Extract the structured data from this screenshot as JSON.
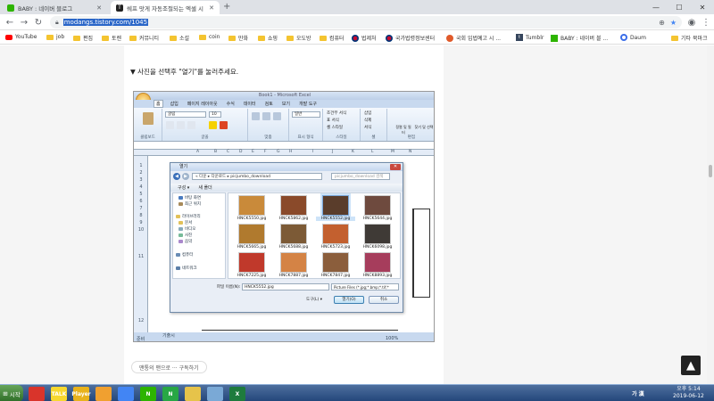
{
  "browser": {
    "tabs": [
      {
        "title": "BABY : 네이버 블로그",
        "active": false
      },
      {
        "title": "쉐프 맛게 자동조절되는 엑셀 시",
        "active": true
      }
    ],
    "url": "modangs.tistory.com/1045",
    "bookmarks": [
      {
        "label": "YouTube",
        "icon": "youtube-icon"
      },
      {
        "label": "job",
        "icon": "folder-icon"
      },
      {
        "label": "편집",
        "icon": "folder-icon"
      },
      {
        "label": "토렌",
        "icon": "folder-icon"
      },
      {
        "label": "커뮤니티",
        "icon": "folder-icon"
      },
      {
        "label": "소설",
        "icon": "folder-icon"
      },
      {
        "label": "coin",
        "icon": "folder-icon"
      },
      {
        "label": "만화",
        "icon": "folder-icon"
      },
      {
        "label": "쇼핑",
        "icon": "folder-icon"
      },
      {
        "label": "오도방",
        "icon": "folder-icon"
      },
      {
        "label": "컴퓨터",
        "icon": "folder-icon"
      },
      {
        "label": "법제처",
        "icon": "flag-icon"
      },
      {
        "label": "국가법령정보센터",
        "icon": "flag-icon"
      },
      {
        "label": "국회 입법예고 시 ...",
        "icon": "globe-icon"
      },
      {
        "label": "Tumblr",
        "icon": "tumblr-icon"
      },
      {
        "label": "BABY : 네이버 블 ...",
        "icon": "naver-icon"
      },
      {
        "label": "Daum",
        "icon": "daum-icon"
      },
      {
        "label": "기타 북마크",
        "icon": "folder-icon"
      }
    ]
  },
  "page": {
    "instruction": "▼ 사진을 선택후 \"열기\"를 눌러주세요.",
    "subscribe": "맨통의 맨으로 ··· 구독하기"
  },
  "excel": {
    "title": "Book1 - Microsoft Excel",
    "menu_tabs": [
      "홈",
      "삽입",
      "페이지 레이아웃",
      "수식",
      "데이터",
      "검토",
      "보기",
      "개발 도구"
    ],
    "ribbon_groups": [
      "클립보드",
      "글꼴",
      "맞춤",
      "표시 형식",
      "스타일",
      "셀",
      "편집"
    ],
    "font_name": "굴림",
    "font_size": "10",
    "number_format": "일반",
    "cell_styles": [
      "조건부 서식",
      "표 서식",
      "셀 스타일"
    ],
    "cells": [
      "삽입",
      "삭제",
      "서식"
    ],
    "edit_buttons": [
      "정렬 및 필터",
      "찾기 및 선택"
    ],
    "columns": [
      "A",
      "B",
      "C",
      "D",
      "E",
      "F",
      "G",
      "H",
      "I",
      "J",
      "K",
      "L",
      "M",
      "N"
    ],
    "rows": [
      "1",
      "2",
      "3",
      "4",
      "5",
      "6",
      "7",
      "8",
      "9",
      "10",
      "11",
      "12"
    ],
    "sheet_tab": "기출시",
    "status": "준비",
    "zoom": "100%"
  },
  "dialog": {
    "title": "열기",
    "path": "« 다운 ▸ 다운로드 ▸ picjumbo_download",
    "search_placeholder": "picjumbo_download 검색",
    "organize": "구성 ▾",
    "new_folder": "새 폴더",
    "nav_items": [
      "바탕 화면",
      "최근 위치",
      "라이브러리",
      "문서",
      "비디오",
      "사진",
      "음악",
      "컴퓨터",
      "네트워크"
    ],
    "files": [
      {
        "name": "HNCK5550.jpg",
        "color": "#c98a3a",
        "selected": false
      },
      {
        "name": "HNCK5862.jpg",
        "color": "#8a4a2a",
        "selected": false
      },
      {
        "name": "HNCK5552.jpg",
        "color": "#5a3d2b",
        "selected": true
      },
      {
        "name": "HNCK5644.jpg",
        "color": "#6e4a3e",
        "selected": false
      },
      {
        "name": "HNCK5665.jpg",
        "color": "#b07a2e",
        "selected": false
      },
      {
        "name": "HNCK5688.jpg",
        "color": "#7c5a36",
        "selected": false
      },
      {
        "name": "HNCK5723.jpg",
        "color": "#c3602f",
        "selected": false
      },
      {
        "name": "HNCK6098.jpg",
        "color": "#3f3a36",
        "selected": false
      },
      {
        "name": "HNCK7225.jpg",
        "color": "#c0392b",
        "selected": false
      },
      {
        "name": "HNCK7887.jpg",
        "color": "#d48345",
        "selected": false
      },
      {
        "name": "HNCK7847.jpg",
        "color": "#8b5e3c",
        "selected": false
      },
      {
        "name": "HNCK8893.jpg",
        "color": "#a63d5c",
        "selected": false
      }
    ],
    "filename_label": "파일 이름(N):",
    "filename_value": "HNCK5552.jpg",
    "filetype": "Picture Files (*.jpg;*.bmp;*.tif;*",
    "tools": "도구(L) ▾",
    "open": "열기(O)",
    "cancel": "취소"
  },
  "taskbar": {
    "start": "시작",
    "apps": [
      {
        "label": "",
        "icon": "power-icon",
        "color": "#d9342b"
      },
      {
        "label": "TALK",
        "icon": "kakaotalk-icon",
        "color": "#f7d82e"
      },
      {
        "label": "Player",
        "icon": "player-icon",
        "color": "#e8b21c"
      },
      {
        "label": "",
        "icon": "gear-orange-icon",
        "color": "#f0a030"
      },
      {
        "label": "",
        "icon": "chrome-icon",
        "color": "#4285f4"
      },
      {
        "label": "N",
        "icon": "naver-icon",
        "color": "#2db400"
      },
      {
        "label": "N",
        "icon": "naver-icon",
        "color": "#28a745"
      },
      {
        "label": "",
        "icon": "folder-icon",
        "color": "#e6c34a"
      },
      {
        "label": "",
        "icon": "photos-icon",
        "color": "#7aa9d6"
      },
      {
        "label": "X",
        "icon": "excel-icon",
        "color": "#1e7b3d"
      }
    ],
    "ime": "가 漢",
    "time": "오후 5:14",
    "date": "2019-06-12"
  }
}
